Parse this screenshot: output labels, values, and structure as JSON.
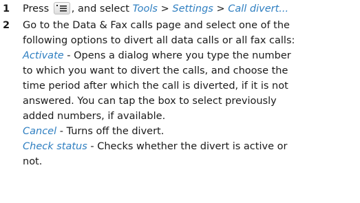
{
  "steps": [
    {
      "number": "1",
      "press_text": "Press",
      "icon": "menu-key-icon",
      "after_icon_text": ", and select",
      "path": {
        "tools": "Tools",
        "sep1": ">",
        "settings": "Settings",
        "sep2": ">",
        "call_divert": "Call divert..."
      }
    },
    {
      "number": "2",
      "intro_lines": [
        "Go to the Data & Fax calls page and select one of the",
        "following options to divert all data calls or all fax calls:"
      ],
      "options": [
        {
          "name": "Activate",
          "description_lines": [
            " - Opens a dialog where you type the number",
            "to which you want to divert the calls, and choose the",
            "time period after which the call is diverted, if it is not",
            "answered. You can tap the box to select previously",
            "added numbers, if available."
          ]
        },
        {
          "name": "Cancel",
          "description_lines": [
            " - Turns off the divert."
          ]
        },
        {
          "name": "Check status",
          "description_lines": [
            " - Checks whether the divert is active or",
            "not."
          ]
        }
      ]
    }
  ],
  "colors": {
    "link": "#2f7fc1",
    "text": "#1a1a1a"
  }
}
